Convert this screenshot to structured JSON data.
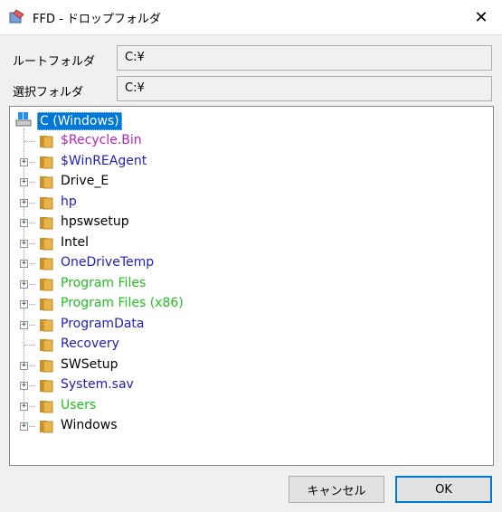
{
  "window": {
    "title": "FFD - ドロップフォルダ",
    "close_glyph": "✕"
  },
  "fields": {
    "root_label": "ルートフォルダ",
    "root_value": "C:¥",
    "selected_label": "選択フォルダ",
    "selected_value": "C:¥"
  },
  "tree": {
    "root": "C (Windows)",
    "items": [
      {
        "label": "$Recycle.Bin",
        "color": "#c020c0",
        "expandable": false
      },
      {
        "label": "$WinREAgent",
        "color": "#2020c0",
        "expandable": true
      },
      {
        "label": "Drive_E",
        "color": "#000000",
        "expandable": true
      },
      {
        "label": "hp",
        "color": "#2020c0",
        "expandable": true
      },
      {
        "label": "hpswsetup",
        "color": "#000000",
        "expandable": true
      },
      {
        "label": "Intel",
        "color": "#000000",
        "expandable": true
      },
      {
        "label": "OneDriveTemp",
        "color": "#2020c0",
        "expandable": true
      },
      {
        "label": "Program Files",
        "color": "#20c020",
        "expandable": true
      },
      {
        "label": "Program Files (x86)",
        "color": "#20c020",
        "expandable": true
      },
      {
        "label": "ProgramData",
        "color": "#2020c0",
        "expandable": true
      },
      {
        "label": "Recovery",
        "color": "#2020c0",
        "expandable": false
      },
      {
        "label": "SWSetup",
        "color": "#000000",
        "expandable": true
      },
      {
        "label": "System.sav",
        "color": "#2020c0",
        "expandable": true
      },
      {
        "label": "Users",
        "color": "#20c020",
        "expandable": true
      },
      {
        "label": "Windows",
        "color": "#000000",
        "expandable": true
      }
    ],
    "expand_glyph": "+"
  },
  "buttons": {
    "cancel": "キャンセル",
    "ok": "OK"
  },
  "colors": {
    "accent": "#0078d7",
    "folder": "#e8b54a"
  }
}
